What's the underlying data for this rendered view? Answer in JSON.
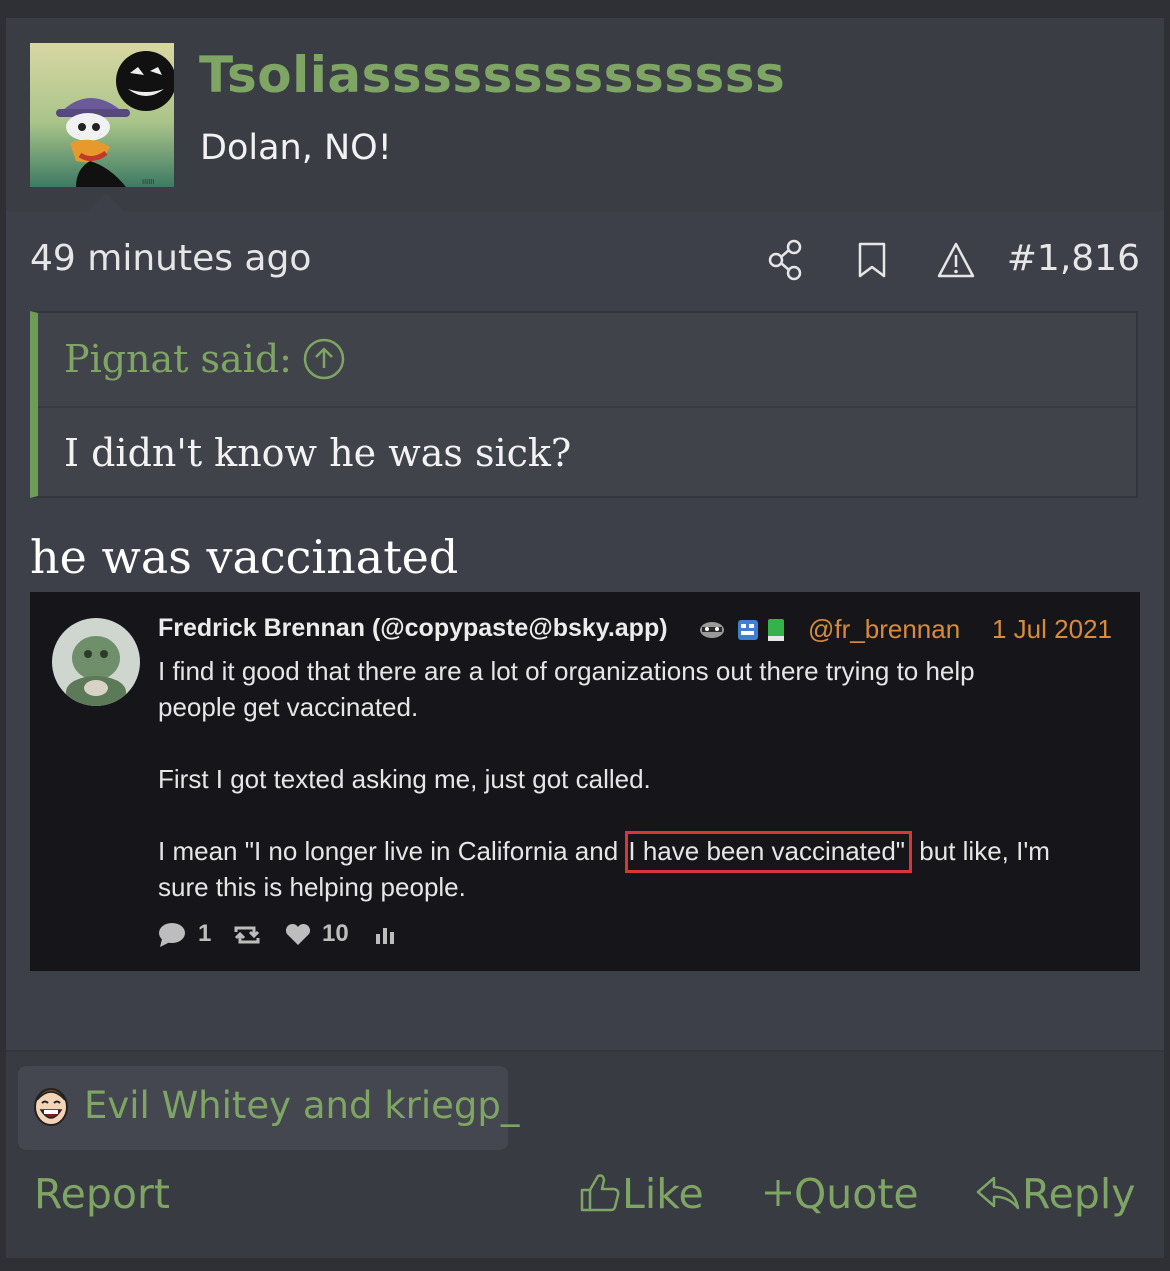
{
  "post": {
    "username": "Tsoliassssssssssssss",
    "user_title": "Dolan, NO!",
    "time": "49 minutes ago",
    "post_number": "#1,816",
    "meta_icons": [
      "share-icon",
      "bookmark-icon",
      "warning-icon"
    ]
  },
  "quote": {
    "author_label": "Pignat said:",
    "text": "I didn't know he was sick?"
  },
  "body_text": "he was vaccinated",
  "embed": {
    "display_name": "Fredrick Brennan (@copypaste@bsky.app)",
    "handle": "@fr_brennan",
    "date": "1 Jul 2021",
    "line1": "I find it good that there are a lot of organizations out there trying to help",
    "line2": "people get vaccinated.",
    "line3": "First I got texted asking me, just got called.",
    "line4_pre": "I mean \"I no longer live in California and ",
    "line4_highlight": "I have been vaccinated\"",
    "line4_post": " but like, I'm",
    "line5": "sure this is helping people.",
    "reply_count": "1",
    "like_count": "10",
    "highlight_color": "#d9363a"
  },
  "reactions": {
    "text": "Evil Whitey and kriegp_"
  },
  "actions": {
    "report": "Report",
    "like": "Like",
    "quote": "Quote",
    "reply": "Reply"
  },
  "colors": {
    "accent": "#7ea563",
    "background": "#3d4048",
    "header": "#3a3d44",
    "handle": "#d98b3a"
  }
}
